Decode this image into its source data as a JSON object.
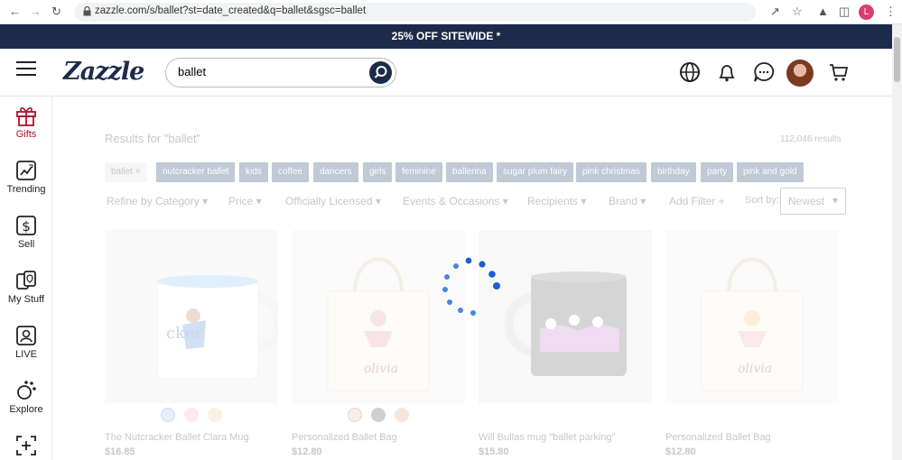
{
  "browser": {
    "url": "zazzle.com/s/ballet?st=date_created&q=ballet&sgsc=ballet",
    "profile_initial": "L"
  },
  "promo": {
    "text": "25% OFF SITEWIDE *"
  },
  "header": {
    "logo": "Zazzle",
    "search_value": "ballet"
  },
  "sidebar": {
    "items": [
      {
        "label": "Gifts",
        "icon": "gift-icon"
      },
      {
        "label": "Trending",
        "icon": "trending-icon"
      },
      {
        "label": "Sell",
        "icon": "dollar-icon"
      },
      {
        "label": "My Stuff",
        "icon": "mystuff-icon"
      },
      {
        "label": "LIVE",
        "icon": "live-icon"
      },
      {
        "label": "Explore",
        "icon": "explore-icon"
      }
    ]
  },
  "results": {
    "heading": "Results for \"ballet\"",
    "count": "112,046 results",
    "tags": [
      "ballet ×",
      "nutcracker ballet",
      "kids",
      "coffee",
      "dancers",
      "girls",
      "feminine",
      "ballerina",
      "sugar plum fairy",
      "pink christmas",
      "birthday",
      "party",
      "pink and gold"
    ],
    "filters": [
      "Refine by Category",
      "Price",
      "Officially Licensed",
      "Events & Occasions",
      "Recipients",
      "Brand"
    ],
    "add_filter": "Add Filter +",
    "sort_label": "Sort by:",
    "sort_value": "Newest"
  },
  "products": [
    {
      "title": "The Nutcracker Ballet Clara Mug",
      "price": "$16.85",
      "swatches": [
        "#9fc9f0",
        "#f0b4c0",
        "#f2c49c"
      ]
    },
    {
      "title": "Personalized Ballet Bag",
      "price": "$12.80",
      "swatches": [
        "#e6c8a8",
        "#555555",
        "#d9a07c"
      ]
    },
    {
      "title": "Will Bullas mug \"ballet parking\"",
      "price": "$15.80",
      "swatches": []
    },
    {
      "title": "Personalized Ballet Bag",
      "price": "$12.80",
      "swatches": []
    }
  ],
  "colors": {
    "brand": "#1d2b4a",
    "accent": "#b0102d",
    "spinner": "#1a5fd0"
  }
}
